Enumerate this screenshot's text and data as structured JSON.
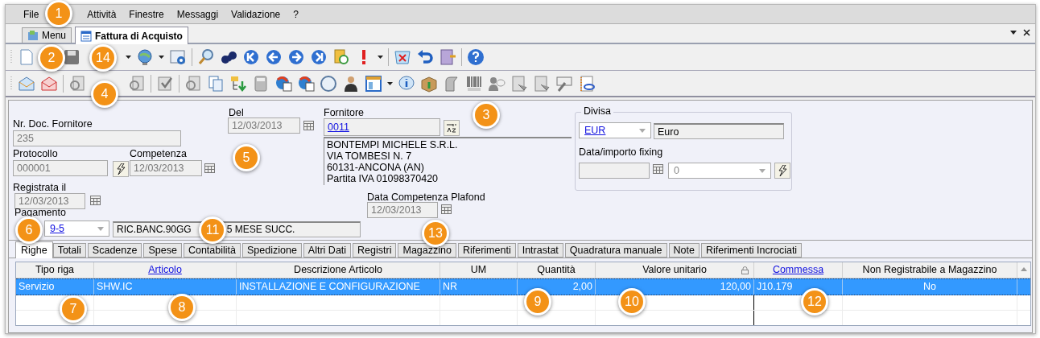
{
  "menu_bar": [
    {
      "label": "File"
    },
    {
      "label": "Attività"
    },
    {
      "label": "Finestre"
    },
    {
      "label": "Messaggi"
    },
    {
      "label": "Validazione"
    },
    {
      "label": "?"
    }
  ],
  "document_tabs": [
    {
      "label": "Menu",
      "selected": false
    },
    {
      "label": "Fattura di Acquisto",
      "selected": true
    }
  ],
  "form": {
    "nr_doc_fornitore": {
      "label": "Nr. Doc. Fornitore",
      "value": "235"
    },
    "del": {
      "label": "Del",
      "value": "12/03/2013"
    },
    "fornitore": {
      "label": "Fornitore",
      "value": "0011",
      "address": [
        "BONTEMPI MICHELE S.R.L.",
        "VIA TOMBESI N. 7",
        "60131-ANCONA (AN)",
        "Partita IVA 01098370420"
      ]
    },
    "protocollo": {
      "label": "Protocollo",
      "value": "000001"
    },
    "competenza": {
      "label": "Competenza",
      "value": "12/03/2013"
    },
    "registrata_il": {
      "label": "Registrata il",
      "value": "12/03/2013"
    },
    "data_competenza_plafond": {
      "label": "Data Competenza Plafond",
      "value": "12/03/2013"
    },
    "pagamento": {
      "label": "Pagamento",
      "value": "9-5",
      "description_parts": [
        "RIC.BANC.90GG",
        "5 MESE SUCC."
      ]
    },
    "divisa": {
      "label": "Divisa",
      "value": "EUR",
      "description": "Euro",
      "fixing_label": "Data/importo fixing",
      "fixing_value": "0"
    }
  },
  "tabs": [
    {
      "label": "Righe",
      "selected": true
    },
    {
      "label": "Totali",
      "selected": false
    },
    {
      "label": "Scadenze",
      "selected": false
    },
    {
      "label": "Spese",
      "selected": false
    },
    {
      "label": "Contabilità",
      "selected": false
    },
    {
      "label": "Spedizione",
      "selected": false
    },
    {
      "label": "Altri Dati",
      "selected": false
    },
    {
      "label": "Registri",
      "selected": false
    },
    {
      "label": "Magazzino",
      "selected": false
    },
    {
      "label": "Riferimenti",
      "selected": false
    },
    {
      "label": "Intrastat",
      "selected": false
    },
    {
      "label": "Quadratura manuale",
      "selected": false
    },
    {
      "label": "Note",
      "selected": false
    },
    {
      "label": "Riferimenti Incrociati",
      "selected": false
    }
  ],
  "table": {
    "columns": [
      {
        "label": "Tipo riga",
        "link": false,
        "locked": false
      },
      {
        "label": "Articolo",
        "link": true,
        "locked": false
      },
      {
        "label": "Descrizione Articolo",
        "link": false,
        "locked": false
      },
      {
        "label": "UM",
        "link": false,
        "locked": false
      },
      {
        "label": "Quantità",
        "link": false,
        "locked": false
      },
      {
        "label": "Valore unitario",
        "link": false,
        "locked": true
      },
      {
        "label": "Commessa",
        "link": true,
        "locked": false
      },
      {
        "label": "Non Registrabile a Magazzino",
        "link": false,
        "locked": false
      }
    ],
    "rows": [
      {
        "selected": true,
        "cells": [
          "Servizio",
          "SHW.IC",
          "INSTALLAZIONE E CONFIGURAZIONE",
          "NR",
          "2,00",
          "120,00",
          "J10.179",
          "No"
        ]
      }
    ]
  },
  "callouts": [
    {
      "label": "1"
    },
    {
      "label": "2"
    },
    {
      "label": "14"
    },
    {
      "label": "4"
    },
    {
      "label": "3"
    },
    {
      "label": "5"
    },
    {
      "label": "6"
    },
    {
      "label": "11"
    },
    {
      "label": "13"
    },
    {
      "label": "7"
    },
    {
      "label": "8"
    },
    {
      "label": "9"
    },
    {
      "label": "10"
    },
    {
      "label": "12"
    }
  ]
}
